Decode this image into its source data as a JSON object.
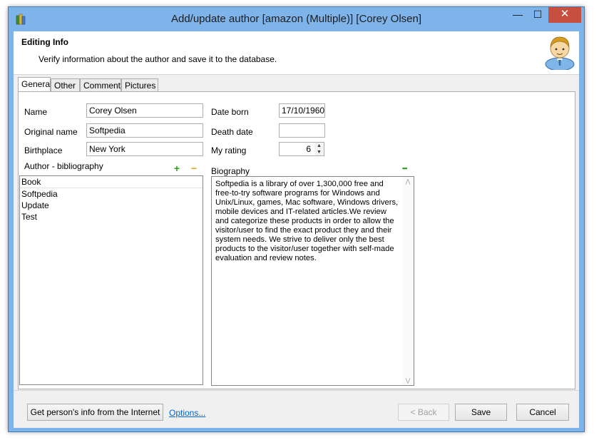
{
  "window": {
    "title": "Add/update author [amazon (Multiple)] [Corey Olsen]",
    "minimize": "—",
    "maximize": "☐",
    "close": "✕"
  },
  "header": {
    "title": "Editing Info",
    "subtitle": "Verify information about the author and save it to the database."
  },
  "tabs": [
    {
      "label": "General",
      "active": true
    },
    {
      "label": "Other"
    },
    {
      "label": "Comment"
    },
    {
      "label": "Pictures"
    }
  ],
  "general": {
    "name_label": "Name",
    "name_value": "Corey Olsen",
    "original_name_label": "Original name",
    "original_name_value": "Softpedia",
    "birthplace_label": "Birthplace",
    "birthplace_value": "New York",
    "date_born_label": "Date born",
    "date_born_value": "17/10/1960",
    "death_date_label": "Death date",
    "death_date_value": "",
    "rating_label": "My rating",
    "rating_value": "6",
    "bibliography_label": "Author - bibliography",
    "bibliography_items": [
      "Book",
      "Softpedia",
      "Update",
      "Test"
    ],
    "add_icon": "plus-icon",
    "remove_icon": "minus-icon",
    "biography_label": "Biography",
    "biography_text": "Softpedia is a library of over 1,300,000 free and free-to-try software programs for Windows and Unix/Linux, games, Mac software, Windows drivers, mobile devices and IT-related articles.We review and categorize these products in order to allow the visitor/user to find the exact product they and their system needs. We strive to deliver only the best products to the visitor/user together with self-made evaluation and review notes.",
    "biography_more": "•••"
  },
  "footer": {
    "get_info_label": "Get person's info from the Internet",
    "options_label": "Options...",
    "back_label": "< Back",
    "save_label": "Save",
    "cancel_label": "Cancel"
  },
  "colors": {
    "titlebar": "#7eb4ea",
    "close": "#c74f40",
    "link": "#0066cc"
  }
}
